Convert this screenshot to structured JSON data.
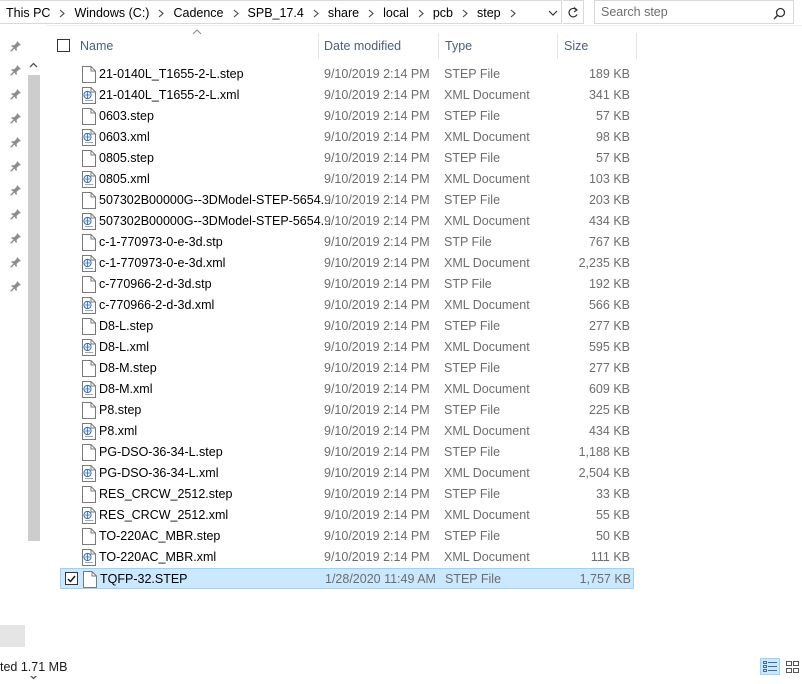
{
  "address": {
    "breadcrumbs": [
      "This PC",
      "Windows (C:)",
      "Cadence",
      "SPB_17.4",
      "share",
      "local",
      "pcb",
      "step"
    ]
  },
  "search": {
    "placeholder": "Search step"
  },
  "columns": {
    "name": "Name",
    "date": "Date modified",
    "type": "Type",
    "size": "Size"
  },
  "files": [
    {
      "name": "21-0140L_T1655-2-L.step",
      "date": "9/10/2019 2:14 PM",
      "type": "STEP File",
      "size": "189 KB",
      "icon": "file-icon"
    },
    {
      "name": "21-0140L_T1655-2-L.xml",
      "date": "9/10/2019 2:14 PM",
      "type": "XML Document",
      "size": "341 KB",
      "icon": "xml-file-icon"
    },
    {
      "name": "0603.step",
      "date": "9/10/2019 2:14 PM",
      "type": "STEP File",
      "size": "57 KB",
      "icon": "file-icon"
    },
    {
      "name": "0603.xml",
      "date": "9/10/2019 2:14 PM",
      "type": "XML Document",
      "size": "98 KB",
      "icon": "xml-file-icon"
    },
    {
      "name": "0805.step",
      "date": "9/10/2019 2:14 PM",
      "type": "STEP File",
      "size": "57 KB",
      "icon": "file-icon"
    },
    {
      "name": "0805.xml",
      "date": "9/10/2019 2:14 PM",
      "type": "XML Document",
      "size": "103 KB",
      "icon": "xml-file-icon"
    },
    {
      "name": "507302B00000G--3DModel-STEP-5654...",
      "date": "9/10/2019 2:14 PM",
      "type": "STEP File",
      "size": "203 KB",
      "icon": "file-icon"
    },
    {
      "name": "507302B00000G--3DModel-STEP-5654...",
      "date": "9/10/2019 2:14 PM",
      "type": "XML Document",
      "size": "434 KB",
      "icon": "xml-file-icon"
    },
    {
      "name": "c-1-770973-0-e-3d.stp",
      "date": "9/10/2019 2:14 PM",
      "type": "STP File",
      "size": "767 KB",
      "icon": "file-icon"
    },
    {
      "name": "c-1-770973-0-e-3d.xml",
      "date": "9/10/2019 2:14 PM",
      "type": "XML Document",
      "size": "2,235 KB",
      "icon": "xml-file-icon"
    },
    {
      "name": "c-770966-2-d-3d.stp",
      "date": "9/10/2019 2:14 PM",
      "type": "STP File",
      "size": "192 KB",
      "icon": "file-icon"
    },
    {
      "name": "c-770966-2-d-3d.xml",
      "date": "9/10/2019 2:14 PM",
      "type": "XML Document",
      "size": "566 KB",
      "icon": "xml-file-icon"
    },
    {
      "name": "D8-L.step",
      "date": "9/10/2019 2:14 PM",
      "type": "STEP File",
      "size": "277 KB",
      "icon": "file-icon"
    },
    {
      "name": "D8-L.xml",
      "date": "9/10/2019 2:14 PM",
      "type": "XML Document",
      "size": "595 KB",
      "icon": "xml-file-icon"
    },
    {
      "name": "D8-M.step",
      "date": "9/10/2019 2:14 PM",
      "type": "STEP File",
      "size": "277 KB",
      "icon": "file-icon"
    },
    {
      "name": "D8-M.xml",
      "date": "9/10/2019 2:14 PM",
      "type": "XML Document",
      "size": "609 KB",
      "icon": "xml-file-icon"
    },
    {
      "name": "P8.step",
      "date": "9/10/2019 2:14 PM",
      "type": "STEP File",
      "size": "225 KB",
      "icon": "file-icon"
    },
    {
      "name": "P8.xml",
      "date": "9/10/2019 2:14 PM",
      "type": "XML Document",
      "size": "434 KB",
      "icon": "xml-file-icon"
    },
    {
      "name": "PG-DSO-36-34-L.step",
      "date": "9/10/2019 2:14 PM",
      "type": "STEP File",
      "size": "1,188 KB",
      "icon": "file-icon"
    },
    {
      "name": "PG-DSO-36-34-L.xml",
      "date": "9/10/2019 2:14 PM",
      "type": "XML Document",
      "size": "2,504 KB",
      "icon": "xml-file-icon"
    },
    {
      "name": "RES_CRCW_2512.step",
      "date": "9/10/2019 2:14 PM",
      "type": "STEP File",
      "size": "33 KB",
      "icon": "file-icon"
    },
    {
      "name": "RES_CRCW_2512.xml",
      "date": "9/10/2019 2:14 PM",
      "type": "XML Document",
      "size": "55 KB",
      "icon": "xml-file-icon"
    },
    {
      "name": "TO-220AC_MBR.step",
      "date": "9/10/2019 2:14 PM",
      "type": "STEP File",
      "size": "50 KB",
      "icon": "file-icon"
    },
    {
      "name": "TO-220AC_MBR.xml",
      "date": "9/10/2019 2:14 PM",
      "type": "XML Document",
      "size": "111 KB",
      "icon": "xml-file-icon"
    },
    {
      "name": "TQFP-32.STEP",
      "date": "1/28/2020 11:49 AM",
      "type": "STEP File",
      "size": "1,757 KB",
      "icon": "file-icon",
      "selected": true
    }
  ],
  "status": {
    "text": "ted  1.71 MB"
  },
  "colors": {
    "selection_bg": "#cce8ff",
    "selection_border": "#99d1ff",
    "header_text": "#4c607a",
    "secondary_text": "#6d6d6d"
  }
}
